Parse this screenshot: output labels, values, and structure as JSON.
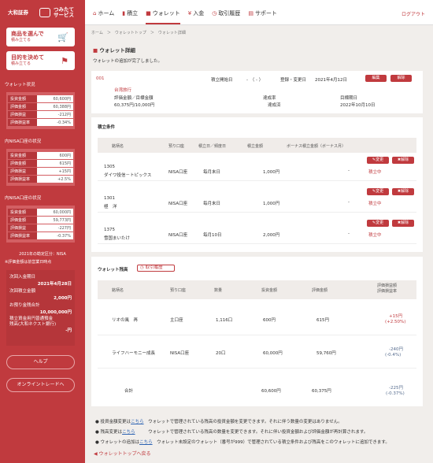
{
  "brand": {
    "name1": "大和証券",
    "name2": "つみたて\nサービス"
  },
  "side": {
    "btn1": {
      "title": "商品を選んで",
      "sub": "積み立てる"
    },
    "btn2": {
      "title": "目的を決めて",
      "sub": "積み立てる"
    },
    "wallet_status": "ウォレット状況",
    "w1": [
      [
        "投資金額",
        "60,600円"
      ],
      [
        "評価金額",
        "60,388円"
      ],
      [
        "評価損益",
        "-212円"
      ],
      [
        "評価損益率",
        "-0.34%"
      ]
    ],
    "nisa_status": "内NISA口座の状況",
    "w2": [
      [
        "投資金額",
        "600円"
      ],
      [
        "評価金額",
        "615円"
      ],
      [
        "評価損益",
        "+15円"
      ],
      [
        "評価損益率",
        "+2.5%"
      ]
    ],
    "nisa2_status": "内NISA口座の状況",
    "w3": [
      [
        "投資金額",
        "60,000円"
      ],
      [
        "評価金額",
        "59,773円"
      ],
      [
        "評価損益",
        "-227円"
      ],
      [
        "評価損益率",
        "-0.37%"
      ]
    ],
    "nisa_note": "2021年の勘定区分：NISA",
    "eval_note": "※評価金額は前営業日時点",
    "next_label": "次回入金期日",
    "next_date": "2021年4月28日",
    "next_amt_label": "次回積立金額",
    "next_amt": "2,000円",
    "pay_label": "お預り金残合計",
    "pay_amt": "10,000,000円",
    "bank_label": "積立資金用円普通預金\n残高(大和ネクスト銀行)",
    "bank_amt": "-円",
    "help": "ヘルプ",
    "online": "オンライントレードへ"
  },
  "nav": {
    "home": "ホーム",
    "tsumitate": "積立",
    "wallet": "ウォレット",
    "nyukin": "入金",
    "history": "取引履歴",
    "support": "サポート",
    "logout": "ログアウト"
  },
  "breadcrumb": "ホーム　＞　ウォレットトップ　＞　ウォレット詳細",
  "detail": {
    "title": "ウォレット詳細",
    "msg": "ウォレットの追加が完了しました。"
  },
  "wallet": {
    "id": "001",
    "start_label": "積立開始日",
    "start_val": "-　（ - ）",
    "reg_label": "登録・変更日",
    "reg_val": "2021年4月12日",
    "edit": "編集",
    "del": "解除",
    "purpose": "台湾旅行",
    "amt_label": "評価金額／目標金額",
    "amt_val": "60,375円/10,000円",
    "rate_label": "達成率",
    "rate_val": "達成済",
    "goal_label": "目標期日",
    "goal_val": "2022年10月10日"
  },
  "cond": {
    "title": "積立条件",
    "headers": [
      "銘柄名",
      "預り口座",
      "積立日／頻度日",
      "積立金額",
      "ボーナス積立金額（ボーナス月）"
    ],
    "rows": [
      {
        "code": "1305",
        "name": "ダイワ投信－トピックス",
        "acct": "NISA口座",
        "freq": "毎月末日",
        "amt": "1,000円",
        "bonus": "-",
        "status": "積立中"
      },
      {
        "code": "1301",
        "name": "極　洋",
        "acct": "NISA口座",
        "freq": "毎月末日",
        "amt": "1,000円",
        "bonus": "-",
        "status": "積立中"
      },
      {
        "code": "1375",
        "name": "雪国まいたけ",
        "acct": "NISA口座",
        "freq": "毎月10日",
        "amt": "2,000円",
        "bonus": "-",
        "status": "積立中"
      }
    ],
    "change": "変更",
    "cancel": "解除"
  },
  "bal": {
    "title": "ウォレット残高",
    "history_btn": "取引履歴",
    "headers": [
      "銘柄名",
      "預り口座",
      "数量",
      "投資金額",
      "評価金額",
      "評価損益額\n評価損益率"
    ],
    "rows": [
      {
        "name": "リオの風　再",
        "acct": "主口座",
        "qty": "1,116口",
        "inv": "600円",
        "val": "615円",
        "pl": "+15円",
        "plr": "(+2.50%)"
      },
      {
        "name": "ライフハーモニー成長",
        "acct": "NISA口座",
        "qty": "20口",
        "inv": "60,000円",
        "val": "59,760円",
        "pl": "-240円",
        "plr": "(-0.4%)"
      }
    ],
    "total": {
      "name": "合計",
      "inv": "60,600円",
      "val": "60,375円",
      "pl": "-225円",
      "plr": "(-0.37%)"
    }
  },
  "notes": [
    {
      "pre": "● 投資金額変更は",
      "link": "こちら",
      "post": "　ウォレットで管理されている残高の投資金額を変更できます。それに伴う数量の変更はありません。"
    },
    {
      "pre": "● 残高変更は",
      "link": "こちら",
      "post": "　　　ウォレットで管理されている残高の数量を変更できます。それに伴い投資金額および評価金額が再計算されます。"
    },
    {
      "pre": "● ウォレットの追加は",
      "link": "こちら",
      "post": "　ウォレット未設定のウォレット（番号が999）で管理されている積立条件および残高をこのウォレットに追加できます。"
    }
  ],
  "back": "ウォレットトップへ戻る"
}
